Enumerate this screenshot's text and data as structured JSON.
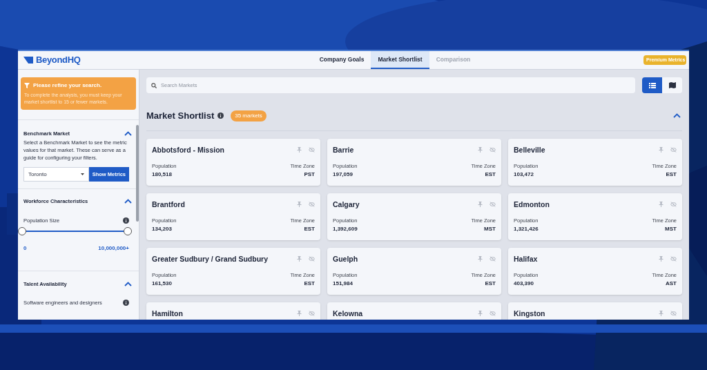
{
  "app": {
    "logo": "BeyondHQ",
    "tabs": [
      {
        "label": "Company Goals",
        "selected": false,
        "disabled": false
      },
      {
        "label": "Market Shortlist",
        "selected": true,
        "disabled": false
      },
      {
        "label": "Comparison",
        "selected": false,
        "disabled": true
      }
    ],
    "premium_button": "Premium Metrics"
  },
  "sidebar": {
    "alert": {
      "title": "Please refine your search.",
      "text": "To complete the analysis, you must keep your market shortlist to 15 or fewer markets."
    },
    "benchmark": {
      "title": "Benchmark Market",
      "expanded": true,
      "text": "Select a Benchmark Market to see the metric values for that market. These can serve as a guide for configuring your filters.",
      "select_value": "Toronto",
      "button": "Show Metrics"
    },
    "workforce": {
      "title": "Workforce Characteristics",
      "expanded": true,
      "slider_label": "Population Size",
      "level": 1,
      "min_label": "0",
      "max_label": "10,000,000+"
    },
    "talent": {
      "title": "Talent Availability",
      "expanded": true,
      "slider_label": "Software engineers and designers"
    }
  },
  "main": {
    "search": {
      "placeholder": "Search Markets"
    },
    "view_toggle": [
      {
        "kind": "list",
        "selected": true
      },
      {
        "kind": "map",
        "selected": false
      }
    ],
    "title": "Market Shortlist",
    "count_badge": "35 markets",
    "expanded": true,
    "cards": [
      {
        "name": "Abbotsford - Mission",
        "population_label": "Population",
        "population": "180,518",
        "timezone_label": "Time Zone",
        "timezone": "PST"
      },
      {
        "name": "Barrie",
        "population_label": "Population",
        "population": "197,059",
        "timezone_label": "Time Zone",
        "timezone": "EST"
      },
      {
        "name": "Belleville",
        "population_label": "Population",
        "population": "103,472",
        "timezone_label": "Time Zone",
        "timezone": "EST"
      },
      {
        "name": "Brantford",
        "population_label": "Population",
        "population": "134,203",
        "timezone_label": "Time Zone",
        "timezone": "EST"
      },
      {
        "name": "Calgary",
        "population_label": "Population",
        "population": "1,392,609",
        "timezone_label": "Time Zone",
        "timezone": "MST"
      },
      {
        "name": "Edmonton",
        "population_label": "Population",
        "population": "1,321,426",
        "timezone_label": "Time Zone",
        "timezone": "MST"
      },
      {
        "name": "Greater Sudbury / Grand Sudbury",
        "population_label": "Population",
        "population": "161,530",
        "timezone_label": "Time Zone",
        "timezone": "EST"
      },
      {
        "name": "Guelph",
        "population_label": "Population",
        "population": "151,984",
        "timezone_label": "Time Zone",
        "timezone": "EST"
      },
      {
        "name": "Halifax",
        "population_label": "Population",
        "population": "403,390",
        "timezone_label": "Time Zone",
        "timezone": "AST"
      },
      {
        "name": "Hamilton"
      },
      {
        "name": "Kelowna"
      },
      {
        "name": "Kingston"
      }
    ]
  }
}
